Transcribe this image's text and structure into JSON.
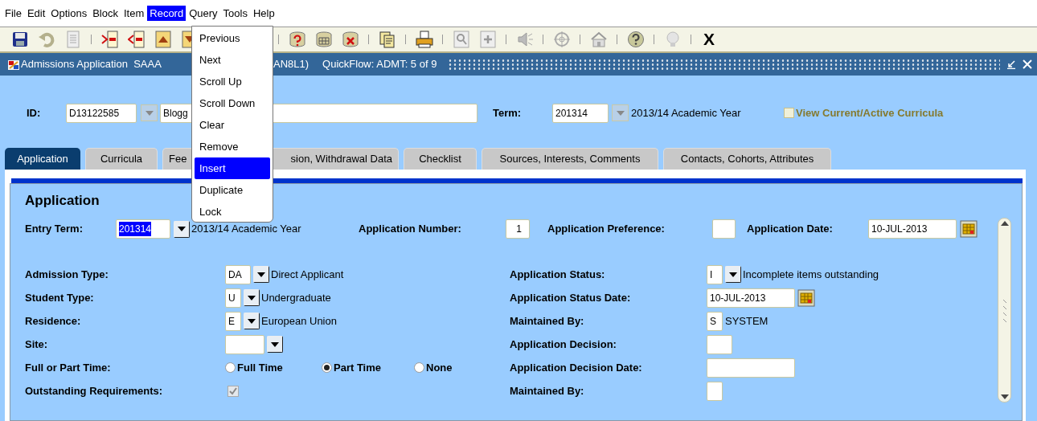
{
  "menu_bar": [
    {
      "label": "File",
      "selected": false
    },
    {
      "label": "Edit",
      "selected": false
    },
    {
      "label": "Options",
      "selected": false
    },
    {
      "label": "Block",
      "selected": false
    },
    {
      "label": "Item",
      "selected": false
    },
    {
      "label": "Record",
      "selected": true
    },
    {
      "label": "Query",
      "selected": false
    },
    {
      "label": "Tools",
      "selected": false
    },
    {
      "label": "Help",
      "selected": false
    }
  ],
  "record_menu": [
    {
      "label": "Previous",
      "selected": false
    },
    {
      "label": "Next",
      "selected": false
    },
    {
      "label": "Scroll Up",
      "selected": false
    },
    {
      "label": "Scroll Down",
      "selected": false
    },
    {
      "label": "Clear",
      "selected": false
    },
    {
      "label": "Remove",
      "selected": false
    },
    {
      "label": "Insert",
      "selected": true
    },
    {
      "label": "Duplicate",
      "selected": false
    },
    {
      "label": "Lock",
      "selected": false
    }
  ],
  "toolbar": {
    "exit_label": "X"
  },
  "window": {
    "title": "Admissions Application  SAAA",
    "title_continued": "AN8L1)",
    "quickflow": "QuickFlow: ADMT: 5 of 9"
  },
  "key_block": {
    "id_label": "ID:",
    "id_value": "D13122585",
    "name_value": "Blogg",
    "term_label": "Term:",
    "term_value": "201314",
    "term_description": "2013/14 Academic Year",
    "view_curricula": {
      "label": "View Current/Active Curricula",
      "checked": false,
      "disabled": true
    }
  },
  "tabs": [
    {
      "label": "Application",
      "selected": true
    },
    {
      "label": "Curricula",
      "selected": false
    },
    {
      "label": "Fee",
      "selected": false
    },
    {
      "label": "sion, Withdrawal Data",
      "selected": false
    },
    {
      "label": "Checklist",
      "selected": false
    },
    {
      "label": "Sources, Interests, Comments",
      "selected": false
    },
    {
      "label": "Contacts, Cohorts, Attributes",
      "selected": false
    }
  ],
  "section_title": "Application",
  "top_row": {
    "entry_term_label": "Entry Term:",
    "entry_term_value": "201314",
    "entry_term_text_selected": true,
    "entry_term_description": "2013/14 Academic Year",
    "number_label": "Application Number:",
    "number_value": "1",
    "preference_label": "Application Preference:",
    "date_label": "Application Date:",
    "date_value": "10-JUL-2013"
  },
  "left_fields": [
    {
      "kind": "lookup",
      "label": "Admission Type:",
      "value": "DA",
      "description": "Direct Applicant"
    },
    {
      "kind": "lookup",
      "label": "Student Type:",
      "value": "U",
      "description": "Undergraduate"
    },
    {
      "kind": "lookup",
      "label": "Residence:",
      "value": "E",
      "description": "European Union"
    },
    {
      "kind": "lookup",
      "label": "Site:"
    },
    {
      "kind": "radio",
      "label": "Full or Part Time:",
      "options": [
        {
          "label": "Full Time",
          "selected": false
        },
        {
          "label": "Part Time",
          "selected": true
        },
        {
          "label": "None",
          "selected": false
        }
      ]
    },
    {
      "kind": "checkbox",
      "label": "Outstanding Requirements:",
      "checked": true,
      "disabled": true
    }
  ],
  "right_fields": [
    {
      "kind": "lookup",
      "label": "Application Status:",
      "value": "I",
      "description": "Incomplete items outstanding"
    },
    {
      "kind": "date",
      "label": "Application Status Date:",
      "value": "10-JUL-2013"
    },
    {
      "kind": "text",
      "label": "Maintained By:",
      "value": "S",
      "description": "SYSTEM"
    },
    {
      "kind": "text",
      "label": "Application Decision:"
    },
    {
      "kind": "text",
      "label": "Application Decision Date:"
    },
    {
      "kind": "text",
      "label": "Maintained By:"
    }
  ]
}
